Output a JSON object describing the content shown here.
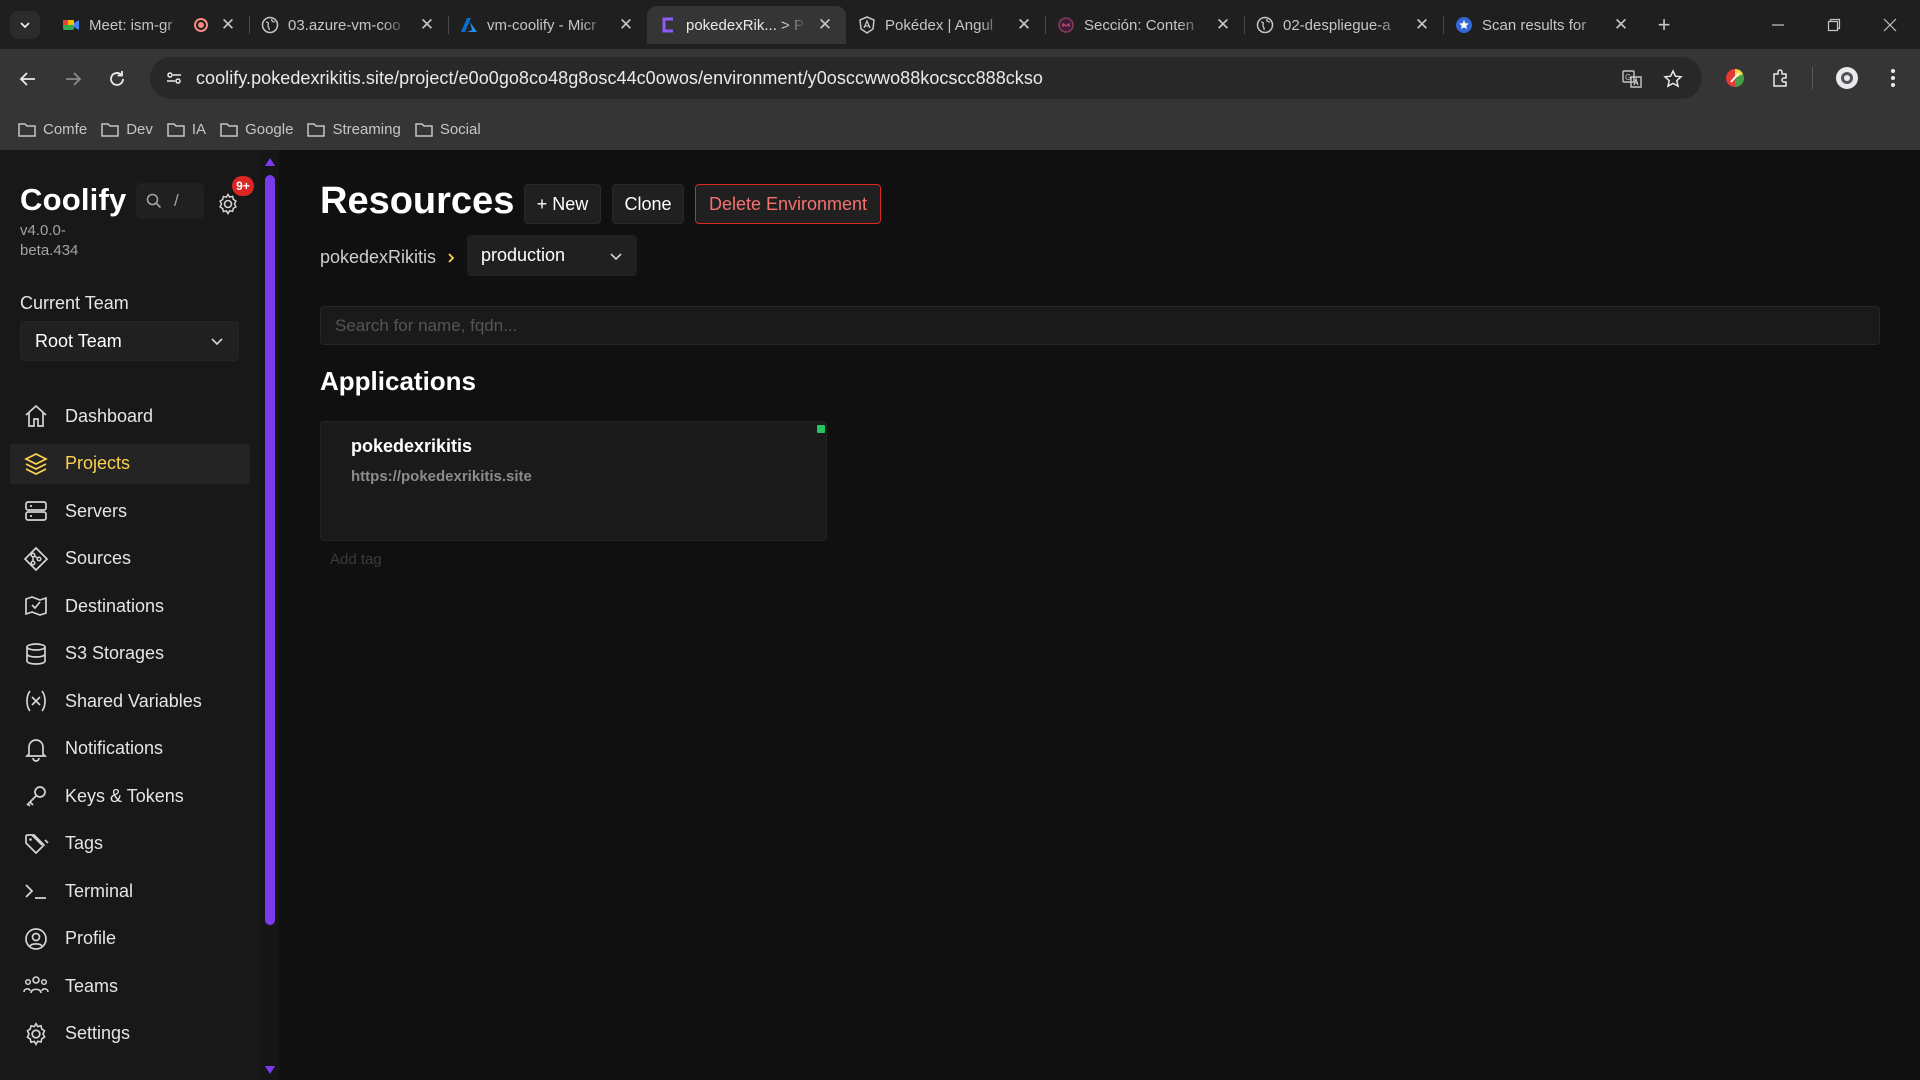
{
  "browser": {
    "tabs": [
      {
        "title": "Meet: ism-gr",
        "active": false,
        "icon": "google-meet-icon",
        "recording": true
      },
      {
        "title": "03.azure-vm-coo",
        "active": false,
        "icon": "globe-icon"
      },
      {
        "title": "vm-coolify - Micr",
        "active": false,
        "icon": "azure-icon"
      },
      {
        "title": "pokedexRik... > P",
        "active": true,
        "icon": "coolify-icon"
      },
      {
        "title": "Pokédex | Angul",
        "active": false,
        "icon": "angular-icon"
      },
      {
        "title": "Sección: Conten",
        "active": false,
        "icon": "moodle-icon"
      },
      {
        "title": "02-despliegue-a",
        "active": false,
        "icon": "globe-icon"
      },
      {
        "title": "Scan results for",
        "active": false,
        "icon": "scan-icon"
      }
    ],
    "url": "coolify.pokedexrikitis.site/project/e0o0go8co48g8osc44c0owos/environment/y0osccwwo88kocscc888ckso",
    "bookmarks": [
      "Comfe",
      "Dev",
      "IA",
      "Google",
      "Streaming",
      "Social"
    ]
  },
  "sidebar": {
    "brand": "Coolify",
    "version": "v4.0.0-beta.434",
    "search_shortcut": "/",
    "notification_badge": "9+",
    "team_label": "Current Team",
    "team_value": "Root Team",
    "nav": [
      {
        "label": "Dashboard",
        "icon": "home-icon",
        "active": false
      },
      {
        "label": "Projects",
        "icon": "layers-icon",
        "active": true
      },
      {
        "label": "Servers",
        "icon": "server-icon",
        "active": false
      },
      {
        "label": "Sources",
        "icon": "git-branch-icon",
        "active": false
      },
      {
        "label": "Destinations",
        "icon": "destination-icon",
        "active": false
      },
      {
        "label": "S3 Storages",
        "icon": "database-icon",
        "active": false
      },
      {
        "label": "Shared Variables",
        "icon": "variable-icon",
        "active": false
      },
      {
        "label": "Notifications",
        "icon": "bell-icon",
        "active": false
      },
      {
        "label": "Keys & Tokens",
        "icon": "key-icon",
        "active": false
      },
      {
        "label": "Tags",
        "icon": "tag-icon",
        "active": false
      },
      {
        "label": "Terminal",
        "icon": "terminal-icon",
        "active": false
      },
      {
        "label": "Profile",
        "icon": "user-icon",
        "active": false
      },
      {
        "label": "Teams",
        "icon": "users-icon",
        "active": false
      },
      {
        "label": "Settings",
        "icon": "gear-icon",
        "active": false
      }
    ]
  },
  "main": {
    "title": "Resources",
    "new_label": "+ New",
    "clone_label": "Clone",
    "delete_label": "Delete Environment",
    "breadcrumb_project": "pokedexRikitis",
    "environment": "production",
    "search_placeholder": "Search for name, fqdn...",
    "applications_title": "Applications",
    "applications": [
      {
        "name": "pokedexrikitis",
        "url": "https://pokedexrikitis.site",
        "status": "running"
      }
    ],
    "add_tag_label": "Add tag"
  },
  "colors": {
    "accent": "#7c3aed",
    "active_nav": "#fcd34d",
    "danger": "#dc2626",
    "status_running": "#22c55e"
  }
}
